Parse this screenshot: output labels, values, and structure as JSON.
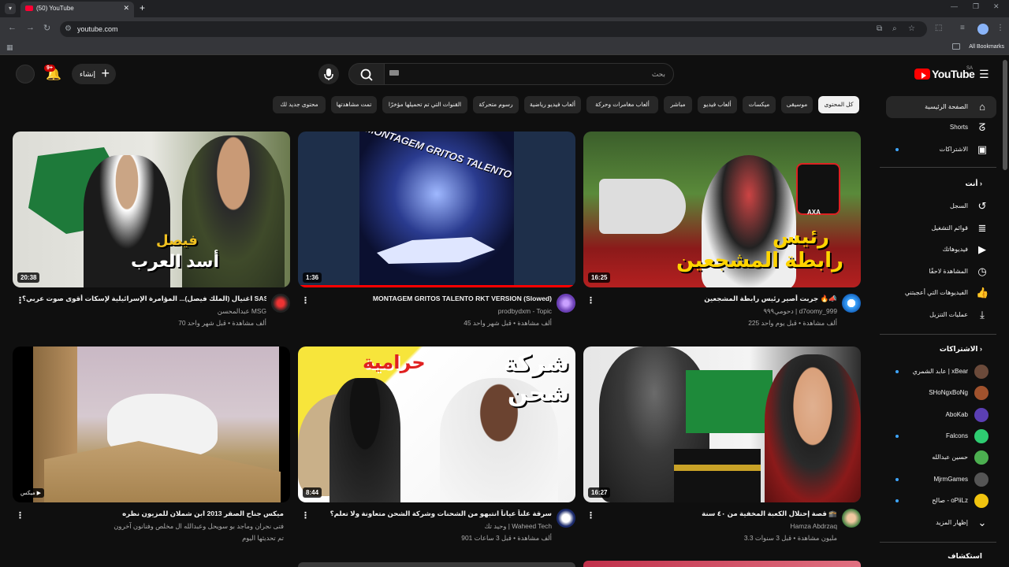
{
  "browser": {
    "tab_title": "(50) YouTube",
    "url": "youtube.com",
    "all_bookmarks": "All Bookmarks"
  },
  "header": {
    "notifications_badge": "9+",
    "create_label": "إنشاء",
    "search_placeholder": "بحث",
    "logo_text": "YouTube",
    "logo_country": "SA"
  },
  "chips": [
    "كل المحتوى",
    "موسيقى",
    "ميكسات",
    "ألعاب فيديو",
    "مباشر",
    "ألعاب مغامرات وحركة",
    "ألعاب فيديو رياضية",
    "رسوم متحركة",
    "القنوات التي تم تحميلها مؤخرًا",
    "تمت مشاهدتها",
    "محتوى جديد لك"
  ],
  "sidebar": {
    "main": [
      {
        "label": "الصفحة الرئيسية",
        "icon": "home-icon"
      },
      {
        "label": "Shorts",
        "icon": "shorts-icon"
      },
      {
        "label": "الاشتراكات",
        "icon": "subscriptions-icon"
      }
    ],
    "you_header": "أنت",
    "you": [
      {
        "label": "السجل",
        "icon": "history-icon"
      },
      {
        "label": "قوائم التشغيل",
        "icon": "playlist-icon"
      },
      {
        "label": "فيديوهاتك",
        "icon": "your-videos-icon"
      },
      {
        "label": "المشاهدة لاحقًا",
        "icon": "clock-icon"
      },
      {
        "label": "الفيديوهات التي أعجبتني",
        "icon": "thumb-up-icon"
      },
      {
        "label": "عمليات التنزيل",
        "icon": "download-icon"
      }
    ],
    "subs_header": "الاشتراكات",
    "subs": [
      {
        "label": "عابد الشمري | xBear",
        "color": "#6b4a3a"
      },
      {
        "label": "SHoNgxBoNg",
        "color": "#a0522d"
      },
      {
        "label": "AboKab",
        "color": "#5b3fb4"
      },
      {
        "label": "Falcons",
        "color": "#2ecc71"
      },
      {
        "label": "حسين عبدالله",
        "color": "#4caf50"
      },
      {
        "label": "MjrmGames",
        "color": "#555555"
      },
      {
        "label": "صالح - oPiiLz",
        "color": "#f1c40f"
      }
    ],
    "show_more": "إظهار المزيد",
    "explore": "استكشاف"
  },
  "videos": [
    {
      "title": "جربت أصير رئيس رابطة المشجعين 🔥📣",
      "channel": "دحومي٩٩٩ | d7oomy_999",
      "meta": "225 ألف مشاهدة • قبل يوم واحد",
      "meta2": "",
      "duration": "16:25",
      "overlay": "رئيس رابطة المشجعين",
      "logo_text": "AXA"
    },
    {
      "title": "MONTAGEM GRITOS TALENTO RKT VERSION (Slowed)",
      "channel": "prodbydxm - Topic",
      "meta": "45 ألف مشاهدة • قبل شهر واحد",
      "meta2": "",
      "duration": "1:36",
      "overlay": "MONTAGEM GRITOS TALENTO"
    },
    {
      "title": "اغتيال (الملك فيصل)... المؤامرة الإسرائيلية لإسكات أقوى صوت عربي؟ SASA",
      "channel": "عبدالمحسن MSG",
      "meta": "70 ألف مشاهدة • قبل شهر واحد",
      "meta2": "",
      "duration": "20:38",
      "overlay": "فيصل",
      "overlay2": "أسد العرب"
    },
    {
      "title": "قصة إحتلال الكعبة المخفية من ٤٠ سنة 🕋",
      "channel": "Hamza Abdrzaq",
      "meta": "3.3 مليون مشاهدة • قبل 3 سنوات",
      "meta2": "",
      "duration": "16:27"
    },
    {
      "title": "سرقة علناً عياناً انتبهو من الشحنات وشركة الشحن متعاونة ولا تعلم؟",
      "channel": "وحيد تك | Waheed Tech",
      "meta": "901 ألف مشاهدة • قبل 3 ساعات",
      "meta2": "",
      "duration": "8:44",
      "overlay": "شركة",
      "overlay2": "شحن",
      "overlay3": "حرامية"
    },
    {
      "title": "ميكس جناح الصقر 2013 ابن شملان للمزيون نظره",
      "channel": "فتى نجران وماجد بو سويحل وعبدالله ال مخلص وفنانون آخرون",
      "meta": "تم تحديثها اليوم",
      "meta2": "",
      "duration": "ميكس"
    }
  ]
}
